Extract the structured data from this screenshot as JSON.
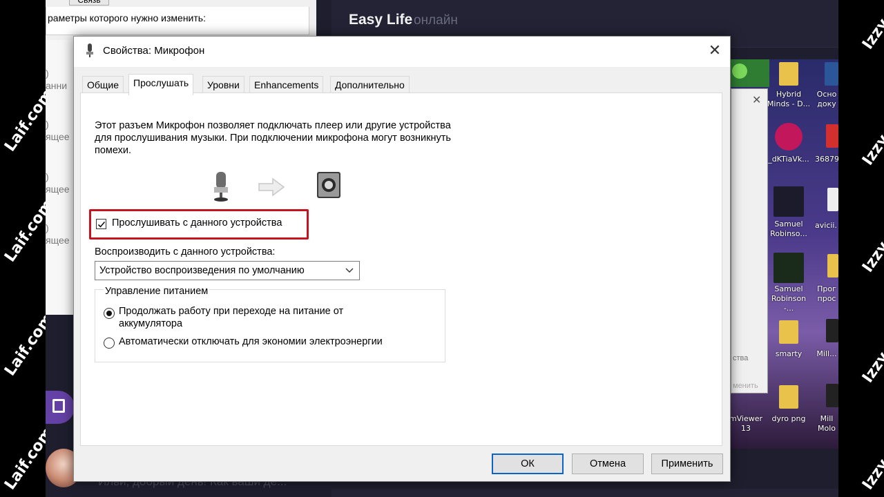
{
  "background_window": {
    "top_label": "Связь",
    "header_text": "раметры которого нужно изменить:",
    "side_texts": [
      ")",
      "анни",
      ")",
      "ящее",
      ")",
      "ящее",
      ")",
      "ящее"
    ]
  },
  "messenger": {
    "chat_title": "Easy Life",
    "chat_status": "онлайн",
    "last_message": "Ильи, добрый день! Как ваши де..."
  },
  "watermarks": {
    "left": "Laif.com",
    "right": "Izzy"
  },
  "desktop": {
    "icons": [
      {
        "label": "Hybrid Minds - D...",
        "icon": "folder-icon"
      },
      {
        "label": "Осно доку",
        "icon": "word-doc-icon"
      },
      {
        "label": "_dKTiaVk...",
        "icon": "image-icon"
      },
      {
        "label": "36879",
        "icon": "image-icon"
      },
      {
        "label": "Samuel Robinso...",
        "icon": "image-icon"
      },
      {
        "label": "avicii.",
        "icon": "file-icon"
      },
      {
        "label": "Samuel Robinson -...",
        "icon": "image-icon"
      },
      {
        "label": "Прог прос",
        "icon": "folder-icon"
      },
      {
        "label": "smarty",
        "icon": "folder-icon"
      },
      {
        "label": "Mill...",
        "icon": "image-icon"
      },
      {
        "label": "dyro png",
        "icon": "folder-icon"
      },
      {
        "label": "Mill Molo",
        "icon": "image-icon"
      },
      {
        "label": "mViewer 13",
        "icon": "app-icon"
      }
    ],
    "subwindow_texts": [
      "ства",
      "менить"
    ]
  },
  "dialog": {
    "title": "Свойства: Микрофон",
    "tabs": [
      {
        "label": "Общие",
        "active": false
      },
      {
        "label": "Прослушать",
        "active": true
      },
      {
        "label": "Уровни",
        "active": false
      },
      {
        "label": "Enhancements",
        "active": false
      },
      {
        "label": "Дополнительно",
        "active": false
      }
    ],
    "description": "Этот разъем Микрофон позволяет подключать плеер или другие устройства для прослушивания музыки. При подключении микрофона могут возникнуть помехи.",
    "listen_checkbox": {
      "label": "Прослушивать с данного устройства",
      "checked": true
    },
    "playback_label": "Воспроизводить с данного устройства:",
    "playback_device": "Устройство воспроизведения по умолчанию",
    "power_group": {
      "title": "Управление питанием",
      "options": [
        {
          "label": "Продолжать работу при переходе на питание от аккумулятора",
          "selected": true
        },
        {
          "label": "Автоматически отключать для экономии электроэнергии",
          "selected": false
        }
      ]
    },
    "buttons": {
      "ok": "ОК",
      "cancel": "Отмена",
      "apply": "Применить"
    }
  },
  "colors": {
    "highlight_border": "#c4141f",
    "default_button_border": "#0a64c8",
    "messenger_bg": "#1e1e2e"
  }
}
